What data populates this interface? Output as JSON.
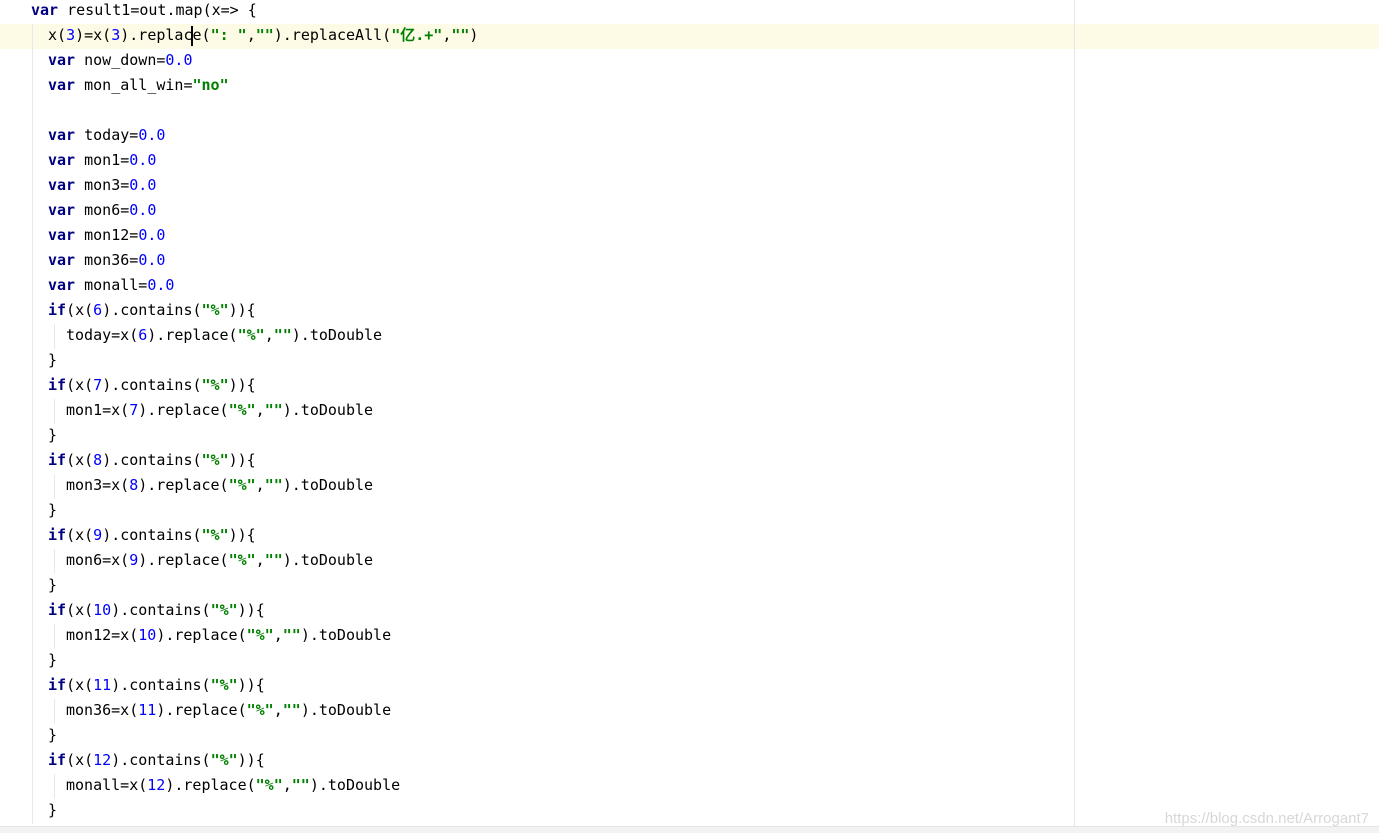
{
  "editor": {
    "current_line_index": 1,
    "lines": [
      {
        "tokens": [
          {
            "t": "kw",
            "v": "var"
          },
          {
            "t": "txt",
            "v": " result1=out.map(x=> {"
          }
        ]
      },
      {
        "tokens": [
          {
            "t": "txt",
            "v": "x("
          },
          {
            "t": "num",
            "v": "3"
          },
          {
            "t": "txt",
            "v": ")=x("
          },
          {
            "t": "num",
            "v": "3"
          },
          {
            "t": "txt",
            "v": ").replace("
          },
          {
            "t": "str",
            "v": "\": \""
          },
          {
            "t": "txt",
            "v": ","
          },
          {
            "t": "str",
            "v": "\"\""
          },
          {
            "t": "txt",
            "v": ").replaceAll("
          },
          {
            "t": "str",
            "v": "\"亿.+\""
          },
          {
            "t": "txt",
            "v": ","
          },
          {
            "t": "str",
            "v": "\"\""
          },
          {
            "t": "txt",
            "v": ")"
          }
        ]
      },
      {
        "tokens": [
          {
            "t": "kw",
            "v": "var"
          },
          {
            "t": "txt",
            "v": " now_down="
          },
          {
            "t": "num",
            "v": "0.0"
          }
        ]
      },
      {
        "tokens": [
          {
            "t": "kw",
            "v": "var"
          },
          {
            "t": "txt",
            "v": " mon_all_win="
          },
          {
            "t": "str",
            "v": "\"no\""
          }
        ]
      },
      {
        "tokens": []
      },
      {
        "tokens": [
          {
            "t": "kw",
            "v": "var"
          },
          {
            "t": "txt",
            "v": " today="
          },
          {
            "t": "num",
            "v": "0.0"
          }
        ]
      },
      {
        "tokens": [
          {
            "t": "kw",
            "v": "var"
          },
          {
            "t": "txt",
            "v": " mon1="
          },
          {
            "t": "num",
            "v": "0.0"
          }
        ]
      },
      {
        "tokens": [
          {
            "t": "kw",
            "v": "var"
          },
          {
            "t": "txt",
            "v": " mon3="
          },
          {
            "t": "num",
            "v": "0.0"
          }
        ]
      },
      {
        "tokens": [
          {
            "t": "kw",
            "v": "var"
          },
          {
            "t": "txt",
            "v": " mon6="
          },
          {
            "t": "num",
            "v": "0.0"
          }
        ]
      },
      {
        "tokens": [
          {
            "t": "kw",
            "v": "var"
          },
          {
            "t": "txt",
            "v": " mon12="
          },
          {
            "t": "num",
            "v": "0.0"
          }
        ]
      },
      {
        "tokens": [
          {
            "t": "kw",
            "v": "var"
          },
          {
            "t": "txt",
            "v": " mon36="
          },
          {
            "t": "num",
            "v": "0.0"
          }
        ]
      },
      {
        "tokens": [
          {
            "t": "kw",
            "v": "var"
          },
          {
            "t": "txt",
            "v": " monall="
          },
          {
            "t": "num",
            "v": "0.0"
          }
        ]
      },
      {
        "tokens": [
          {
            "t": "kw",
            "v": "if"
          },
          {
            "t": "txt",
            "v": "(x("
          },
          {
            "t": "num",
            "v": "6"
          },
          {
            "t": "txt",
            "v": ").contains("
          },
          {
            "t": "str",
            "v": "\"%\""
          },
          {
            "t": "txt",
            "v": ")){"
          }
        ]
      },
      {
        "tokens": [
          {
            "t": "txt",
            "v": "today=x("
          },
          {
            "t": "num",
            "v": "6"
          },
          {
            "t": "txt",
            "v": ").replace("
          },
          {
            "t": "str",
            "v": "\"%\""
          },
          {
            "t": "txt",
            "v": ","
          },
          {
            "t": "str",
            "v": "\"\""
          },
          {
            "t": "txt",
            "v": ").toDouble"
          }
        ]
      },
      {
        "tokens": [
          {
            "t": "txt",
            "v": "}"
          }
        ]
      },
      {
        "tokens": [
          {
            "t": "kw",
            "v": "if"
          },
          {
            "t": "txt",
            "v": "(x("
          },
          {
            "t": "num",
            "v": "7"
          },
          {
            "t": "txt",
            "v": ").contains("
          },
          {
            "t": "str",
            "v": "\"%\""
          },
          {
            "t": "txt",
            "v": ")){"
          }
        ]
      },
      {
        "tokens": [
          {
            "t": "txt",
            "v": "mon1=x("
          },
          {
            "t": "num",
            "v": "7"
          },
          {
            "t": "txt",
            "v": ").replace("
          },
          {
            "t": "str",
            "v": "\"%\""
          },
          {
            "t": "txt",
            "v": ","
          },
          {
            "t": "str",
            "v": "\"\""
          },
          {
            "t": "txt",
            "v": ").toDouble"
          }
        ]
      },
      {
        "tokens": [
          {
            "t": "txt",
            "v": "}"
          }
        ]
      },
      {
        "tokens": [
          {
            "t": "kw",
            "v": "if"
          },
          {
            "t": "txt",
            "v": "(x("
          },
          {
            "t": "num",
            "v": "8"
          },
          {
            "t": "txt",
            "v": ").contains("
          },
          {
            "t": "str",
            "v": "\"%\""
          },
          {
            "t": "txt",
            "v": ")){"
          }
        ]
      },
      {
        "tokens": [
          {
            "t": "txt",
            "v": "mon3=x("
          },
          {
            "t": "num",
            "v": "8"
          },
          {
            "t": "txt",
            "v": ").replace("
          },
          {
            "t": "str",
            "v": "\"%\""
          },
          {
            "t": "txt",
            "v": ","
          },
          {
            "t": "str",
            "v": "\"\""
          },
          {
            "t": "txt",
            "v": ").toDouble"
          }
        ]
      },
      {
        "tokens": [
          {
            "t": "txt",
            "v": "}"
          }
        ]
      },
      {
        "tokens": [
          {
            "t": "kw",
            "v": "if"
          },
          {
            "t": "txt",
            "v": "(x("
          },
          {
            "t": "num",
            "v": "9"
          },
          {
            "t": "txt",
            "v": ").contains("
          },
          {
            "t": "str",
            "v": "\"%\""
          },
          {
            "t": "txt",
            "v": ")){"
          }
        ]
      },
      {
        "tokens": [
          {
            "t": "txt",
            "v": "mon6=x("
          },
          {
            "t": "num",
            "v": "9"
          },
          {
            "t": "txt",
            "v": ").replace("
          },
          {
            "t": "str",
            "v": "\"%\""
          },
          {
            "t": "txt",
            "v": ","
          },
          {
            "t": "str",
            "v": "\"\""
          },
          {
            "t": "txt",
            "v": ").toDouble"
          }
        ]
      },
      {
        "tokens": [
          {
            "t": "txt",
            "v": "}"
          }
        ]
      },
      {
        "tokens": [
          {
            "t": "kw",
            "v": "if"
          },
          {
            "t": "txt",
            "v": "(x("
          },
          {
            "t": "num",
            "v": "10"
          },
          {
            "t": "txt",
            "v": ").contains("
          },
          {
            "t": "str",
            "v": "\"%\""
          },
          {
            "t": "txt",
            "v": ")){"
          }
        ]
      },
      {
        "tokens": [
          {
            "t": "txt",
            "v": "mon12=x("
          },
          {
            "t": "num",
            "v": "10"
          },
          {
            "t": "txt",
            "v": ").replace("
          },
          {
            "t": "str",
            "v": "\"%\""
          },
          {
            "t": "txt",
            "v": ","
          },
          {
            "t": "str",
            "v": "\"\""
          },
          {
            "t": "txt",
            "v": ").toDouble"
          }
        ]
      },
      {
        "tokens": [
          {
            "t": "txt",
            "v": "}"
          }
        ]
      },
      {
        "tokens": [
          {
            "t": "kw",
            "v": "if"
          },
          {
            "t": "txt",
            "v": "(x("
          },
          {
            "t": "num",
            "v": "11"
          },
          {
            "t": "txt",
            "v": ").contains("
          },
          {
            "t": "str",
            "v": "\"%\""
          },
          {
            "t": "txt",
            "v": ")){"
          }
        ]
      },
      {
        "tokens": [
          {
            "t": "txt",
            "v": "mon36=x("
          },
          {
            "t": "num",
            "v": "11"
          },
          {
            "t": "txt",
            "v": ").replace("
          },
          {
            "t": "str",
            "v": "\"%\""
          },
          {
            "t": "txt",
            "v": ","
          },
          {
            "t": "str",
            "v": "\"\""
          },
          {
            "t": "txt",
            "v": ").toDouble"
          }
        ]
      },
      {
        "tokens": [
          {
            "t": "txt",
            "v": "}"
          }
        ]
      },
      {
        "tokens": [
          {
            "t": "kw",
            "v": "if"
          },
          {
            "t": "txt",
            "v": "(x("
          },
          {
            "t": "num",
            "v": "12"
          },
          {
            "t": "txt",
            "v": ").contains("
          },
          {
            "t": "str",
            "v": "\"%\""
          },
          {
            "t": "txt",
            "v": ")){"
          }
        ]
      },
      {
        "tokens": [
          {
            "t": "txt",
            "v": "monall=x("
          },
          {
            "t": "num",
            "v": "12"
          },
          {
            "t": "txt",
            "v": ").replace("
          },
          {
            "t": "str",
            "v": "\"%\""
          },
          {
            "t": "txt",
            "v": ","
          },
          {
            "t": "str",
            "v": "\"\""
          },
          {
            "t": "txt",
            "v": ").toDouble"
          }
        ]
      },
      {
        "tokens": [
          {
            "t": "txt",
            "v": "}"
          }
        ]
      }
    ]
  },
  "watermark": "https://blog.csdn.net/Arrogant7",
  "colors": {
    "keyword": "#000080",
    "number": "#0000ff",
    "string": "#008000",
    "current_line_bg": "#fdfbe6"
  }
}
